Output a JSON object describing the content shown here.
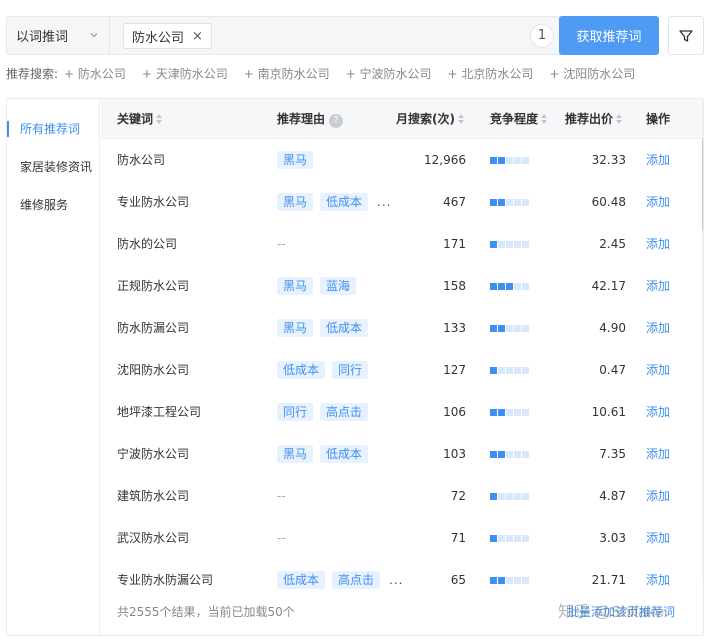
{
  "search": {
    "mode": "以词推词",
    "tag": "防水公司",
    "tag_remove": "×",
    "count": "1",
    "fetch_label": "获取推荐词"
  },
  "recommend": {
    "label": "推荐搜索:",
    "items": [
      "+ 防水公司",
      "+ 天津防水公司",
      "+ 南京防水公司",
      "+ 宁波防水公司",
      "+ 北京防水公司",
      "+ 沈阳防水公司"
    ]
  },
  "sidebar": {
    "items": [
      {
        "label": "所有推荐词",
        "active": true
      },
      {
        "label": "家居装修资讯",
        "active": false
      },
      {
        "label": "维修服务",
        "active": false
      }
    ]
  },
  "table": {
    "headers": {
      "keyword": "关键词",
      "reason": "推荐理由",
      "help": "?",
      "volume": "月搜索(次)",
      "competition": "竞争程度",
      "bid": "推荐出价",
      "action": "操作"
    },
    "rows": [
      {
        "keyword": "防水公司",
        "reasons": [
          "黑马"
        ],
        "more": "",
        "volume": "12,966",
        "competition": 2,
        "bid": "32.33",
        "action": "添加"
      },
      {
        "keyword": "专业防水公司",
        "reasons": [
          "黑马",
          "低成本"
        ],
        "more": "...",
        "volume": "467",
        "competition": 2,
        "bid": "60.48",
        "action": "添加"
      },
      {
        "keyword": "防水的公司",
        "reasons": [],
        "more": "--",
        "volume": "171",
        "competition": 1,
        "bid": "2.45",
        "action": "添加"
      },
      {
        "keyword": "正规防水公司",
        "reasons": [
          "黑马",
          "蓝海"
        ],
        "more": "",
        "volume": "158",
        "competition": 3,
        "bid": "42.17",
        "action": "添加"
      },
      {
        "keyword": "防水防漏公司",
        "reasons": [
          "黑马",
          "低成本"
        ],
        "more": "",
        "volume": "133",
        "competition": 2,
        "bid": "4.90",
        "action": "添加"
      },
      {
        "keyword": "沈阳防水公司",
        "reasons": [
          "低成本",
          "同行"
        ],
        "more": "",
        "volume": "127",
        "competition": 1,
        "bid": "0.47",
        "action": "添加"
      },
      {
        "keyword": "地坪漆工程公司",
        "reasons": [
          "同行",
          "高点击"
        ],
        "more": "",
        "volume": "106",
        "competition": 2,
        "bid": "10.61",
        "action": "添加"
      },
      {
        "keyword": "宁波防水公司",
        "reasons": [
          "黑马",
          "低成本"
        ],
        "more": "",
        "volume": "103",
        "competition": 2,
        "bid": "7.35",
        "action": "添加"
      },
      {
        "keyword": "建筑防水公司",
        "reasons": [],
        "more": "--",
        "volume": "72",
        "competition": 1,
        "bid": "4.87",
        "action": "添加"
      },
      {
        "keyword": "武汉防水公司",
        "reasons": [],
        "more": "--",
        "volume": "71",
        "competition": 1,
        "bid": "3.03",
        "action": "添加"
      },
      {
        "keyword": "专业防水防漏公司",
        "reasons": [
          "低成本",
          "高点击"
        ],
        "more": "...",
        "volume": "65",
        "competition": 2,
        "bid": "21.71",
        "action": "添加"
      }
    ],
    "competition_levels": 5
  },
  "footer": {
    "summary": "共2555个结果，当前已加载50个",
    "link": "批量添加该页推荐词"
  },
  "watermark": "知乎 @Shifake",
  "colors": {
    "accent": "#3d8ff0",
    "button": "#4e9bf3",
    "tag_bg": "#e8f2fe"
  }
}
